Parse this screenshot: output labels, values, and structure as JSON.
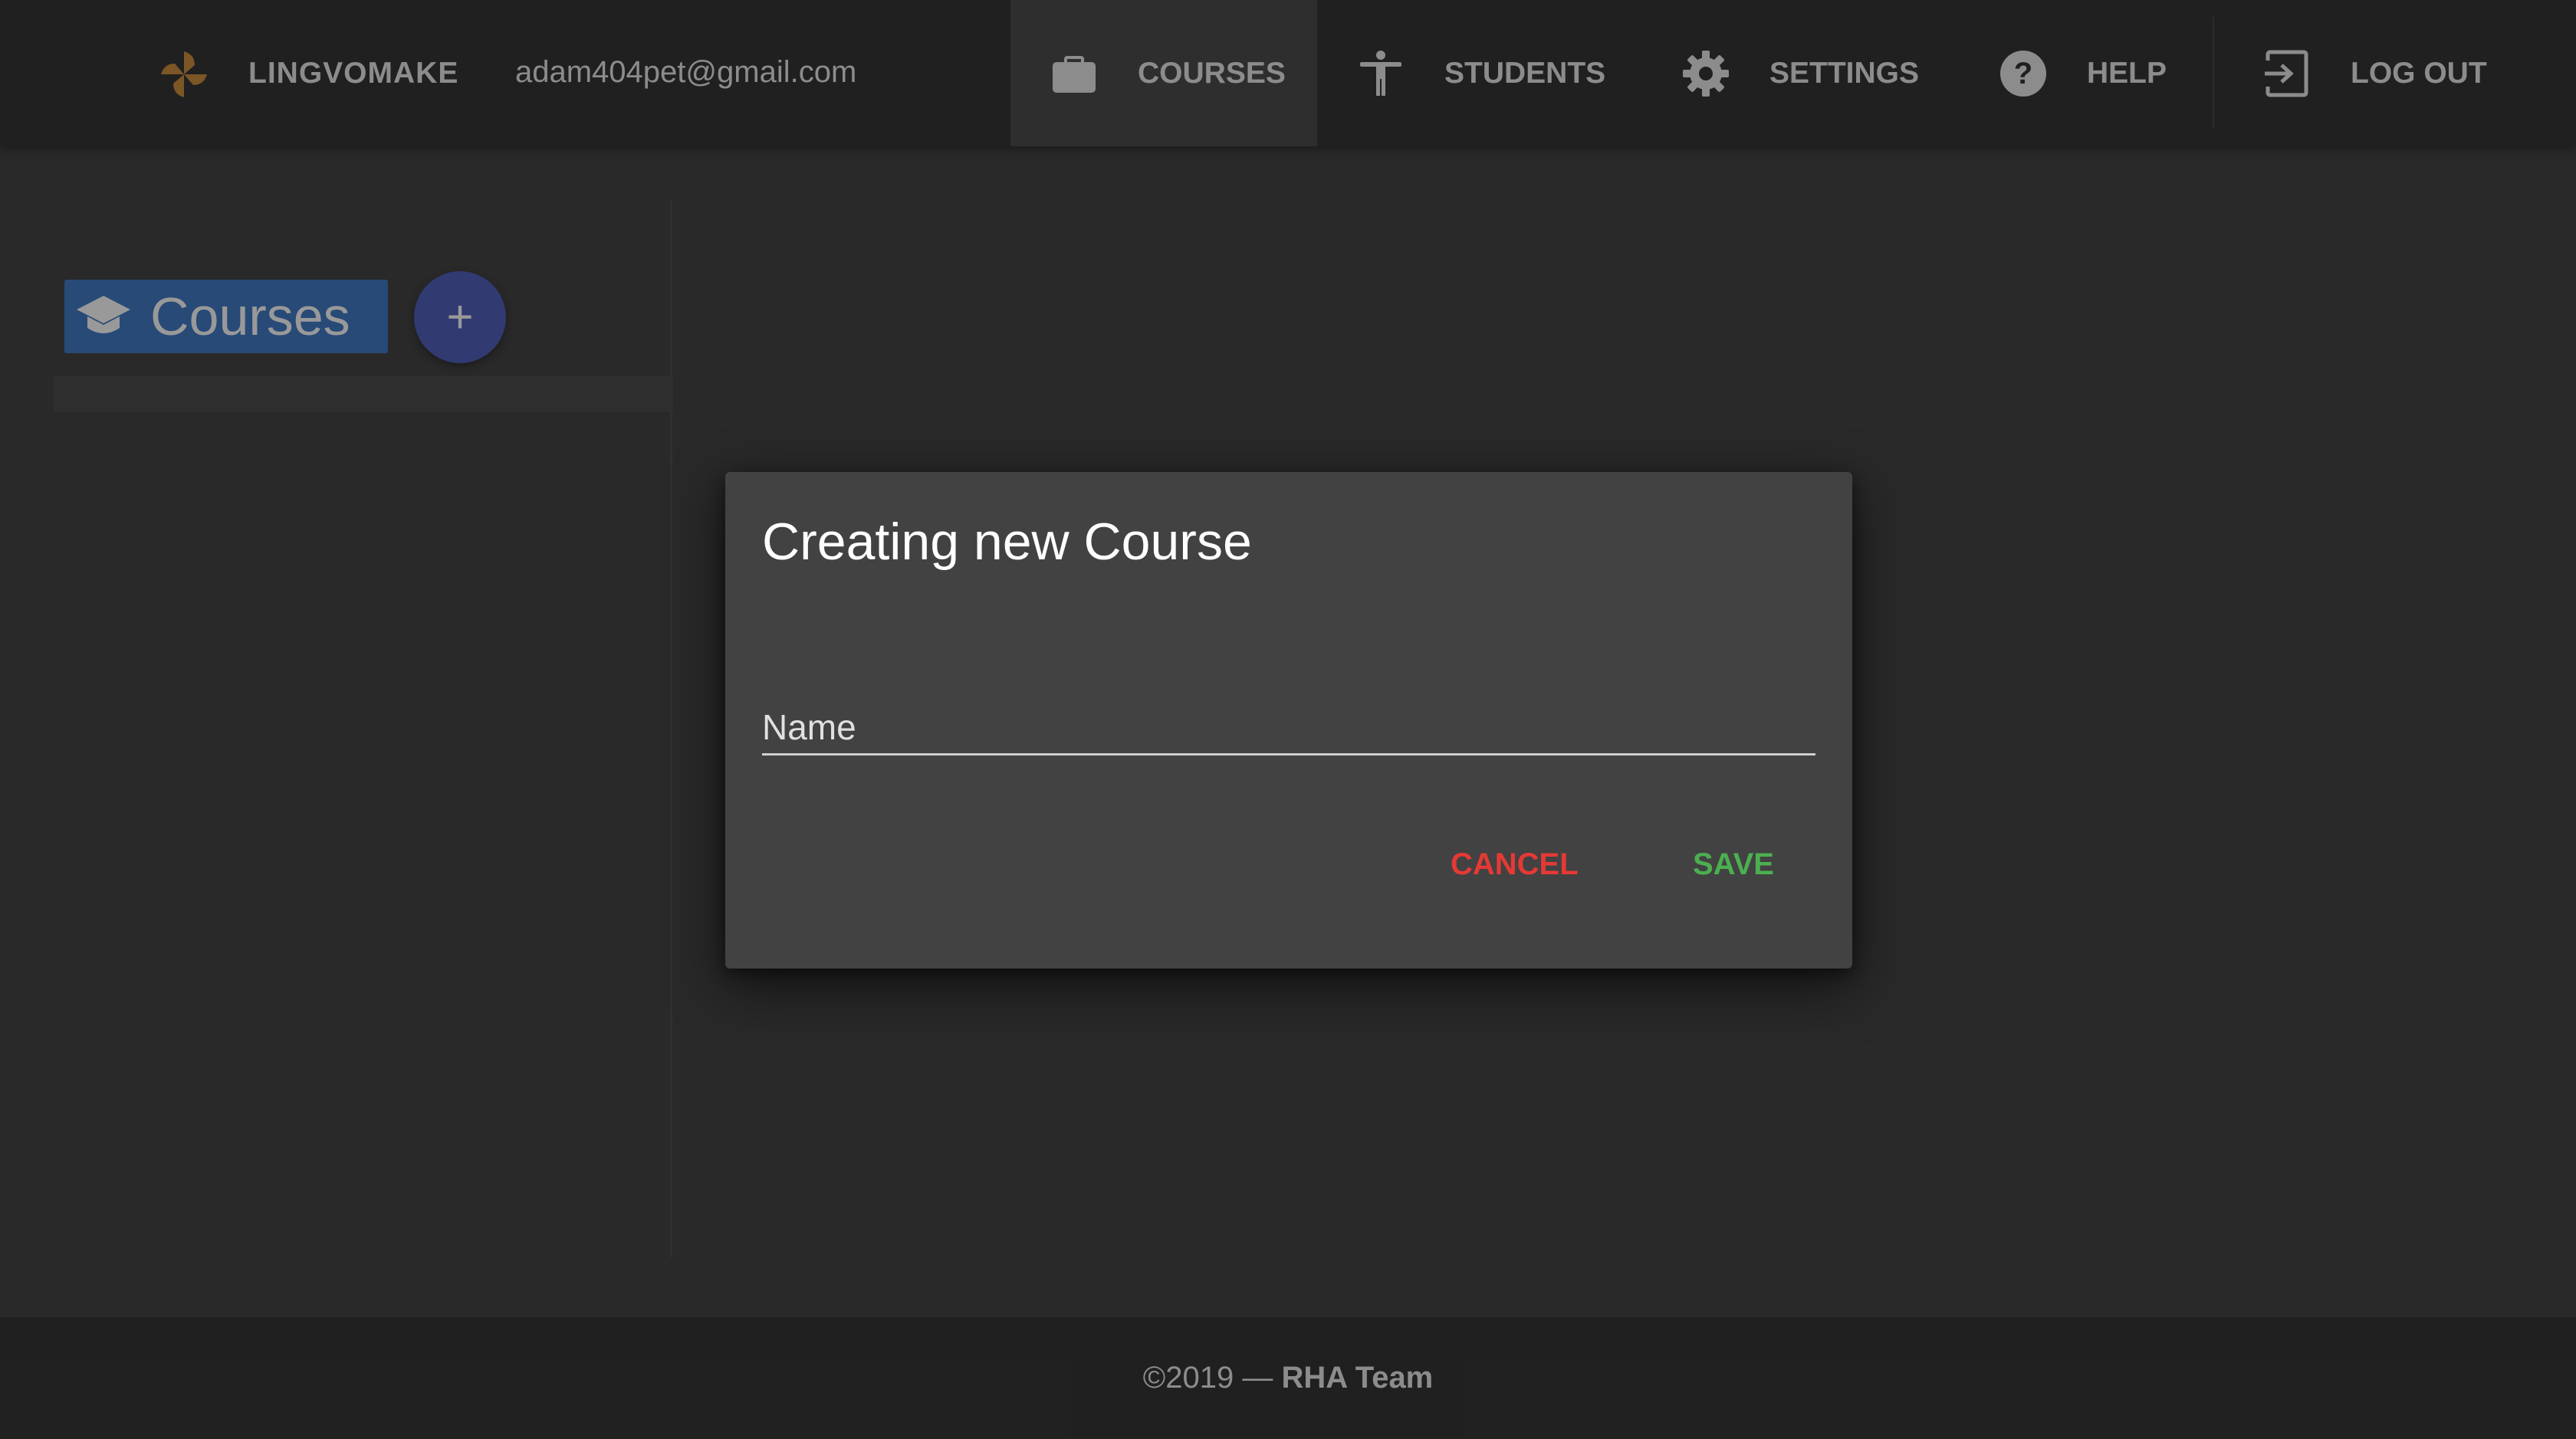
{
  "app": {
    "brand_name": "LINGVOMAKE",
    "user_email": "adam404pet@gmail.com"
  },
  "nav": {
    "items": [
      {
        "label": "COURSES",
        "icon": "briefcase-icon",
        "active": true
      },
      {
        "label": "STUDENTS",
        "icon": "person-icon",
        "active": false
      },
      {
        "label": "SETTINGS",
        "icon": "gear-icon",
        "active": false
      },
      {
        "label": "HELP",
        "icon": "help-circle-icon",
        "active": false
      },
      {
        "label": "LOG OUT",
        "icon": "logout-icon",
        "active": false
      }
    ]
  },
  "sidebar": {
    "title": "Courses",
    "title_icon": "graduation-cap-icon",
    "add_button_label": "+"
  },
  "dialog": {
    "title": "Creating new Course",
    "name_label": "Name",
    "name_value": "",
    "cancel_label": "CANCEL",
    "save_label": "SAVE"
  },
  "footer": {
    "copyright": "©2019 — ",
    "team": "RHA Team"
  },
  "colors": {
    "background": "#303030",
    "appbar": "#212121",
    "courses_header": "#2f6ec0",
    "fab": "#3f51b5",
    "dialog": "#424242",
    "cancel": "#e53935",
    "save": "#4caf50",
    "logo": "#f5a623"
  }
}
